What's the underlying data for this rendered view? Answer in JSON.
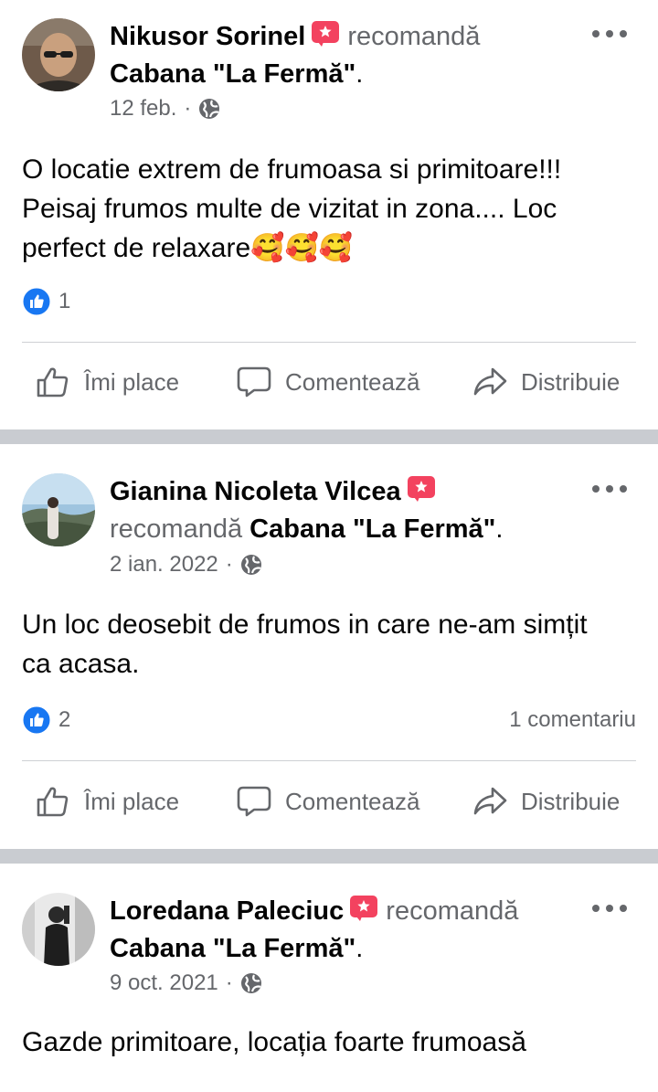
{
  "posts": [
    {
      "author": "Nikusor Sorinel",
      "verb": "recomandă",
      "page": "Cabana \"La Fermă\"",
      "punct": ".",
      "date": "12 feb.",
      "separator": "·",
      "text_lines": [
        "O locatie extrem de frumoasa si primitoare!!!",
        "Peisaj frumos multe de vizitat in zona.... Loc",
        "perfect de relaxare🥰🥰🥰"
      ],
      "likes": "1",
      "comments": ""
    },
    {
      "author": "Gianina Nicoleta Vilcea",
      "verb": "recomandă",
      "page": "Cabana \"La Fermă\"",
      "punct": ".",
      "date": "2 ian. 2022",
      "separator": "·",
      "text_lines": [
        "Un loc deosebit de frumos in care ne-am simțit",
        "ca acasa."
      ],
      "likes": "2",
      "comments": "1 comentariu"
    },
    {
      "author": "Loredana Paleciuc",
      "verb": "recomandă",
      "page": "Cabana \"La Fermă\"",
      "punct": ".",
      "date": "9 oct. 2021",
      "separator": "·",
      "text_lines": [
        "Gazde primitoare, locația foarte frumoasă"
      ],
      "likes": "",
      "comments": ""
    }
  ],
  "actions": {
    "like": "Îmi place",
    "comment": "Comentează",
    "share": "Distribuie"
  },
  "icons": {
    "recommend": "recommend-star-icon",
    "privacy": "globe-icon",
    "more": "more-dots-icon",
    "like_reaction": "like-reaction-icon",
    "like_action": "thumbs-up-icon",
    "comment_action": "comment-bubble-icon",
    "share_action": "share-arrow-icon"
  },
  "colors": {
    "recommend_badge": "#f3425f",
    "like_blue": "#1877f2",
    "secondary_text": "#65676b",
    "divider": "#c9ccd1"
  }
}
